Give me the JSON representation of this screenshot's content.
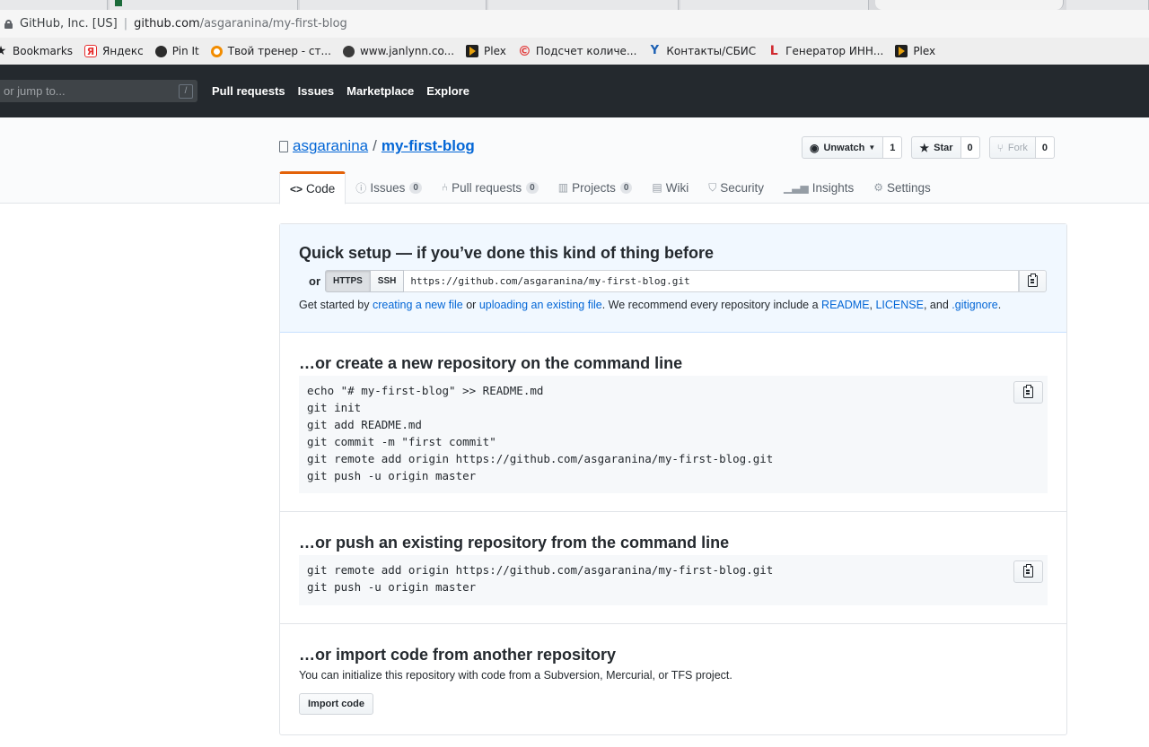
{
  "browser": {
    "org": "GitHub, Inc. [US]",
    "host": "github.com",
    "path": "/asgaranina/my-first-blog",
    "bookmarks": [
      {
        "label": "Bookmarks",
        "icon": "star-icon"
      },
      {
        "label": "Яндекс",
        "icon": "yandex-icon"
      },
      {
        "label": "Pin It",
        "icon": "pin-it-icon"
      },
      {
        "label": "Твой тренер - ст...",
        "icon": "trainer-icon"
      },
      {
        "label": "www.janlynn.co...",
        "icon": "globe-icon"
      },
      {
        "label": "Plex",
        "icon": "plex-icon"
      },
      {
        "label": "Подсчет количе...",
        "icon": "copyright-icon"
      },
      {
        "label": "Контакты/СБИС",
        "icon": "contacts-icon"
      },
      {
        "label": "Генератор ИНН...",
        "icon": "inn-icon"
      },
      {
        "label": "Plex",
        "icon": "plex-icon"
      }
    ]
  },
  "header": {
    "search_placeholder": "or jump to...",
    "slash_key": "/",
    "nav": [
      "Pull requests",
      "Issues",
      "Marketplace",
      "Explore"
    ]
  },
  "repo": {
    "owner": "asgaranina",
    "separator": "/",
    "name": "my-first-blog",
    "unwatch_label": "Unwatch",
    "watch_count": "1",
    "star_label": "Star",
    "star_count": "0",
    "fork_label": "Fork",
    "fork_count": "0",
    "tabs": [
      {
        "label": "Code",
        "icon": "code-icon"
      },
      {
        "label": "Issues",
        "icon": "issue-icon",
        "count": "0"
      },
      {
        "label": "Pull requests",
        "icon": "pull-request-icon",
        "count": "0"
      },
      {
        "label": "Projects",
        "icon": "project-icon",
        "count": "0"
      },
      {
        "label": "Wiki",
        "icon": "book-icon"
      },
      {
        "label": "Security",
        "icon": "shield-icon"
      },
      {
        "label": "Insights",
        "icon": "graph-icon"
      },
      {
        "label": "Settings",
        "icon": "gear-icon"
      }
    ]
  },
  "quick_setup": {
    "title": "Quick setup — if you’ve done this kind of thing before",
    "or": "or",
    "https": "HTTPS",
    "ssh": "SSH",
    "clone_url": "https://github.com/asgaranina/my-first-blog.git",
    "help_1": "Get started by ",
    "help_link_1": "creating a new file",
    "help_2": " or ",
    "help_link_2": "uploading an existing file",
    "help_3": ". We recommend every repository include a ",
    "help_link_3": "README",
    "help_4": ", ",
    "help_link_4": "LICENSE",
    "help_5": ", and ",
    "help_link_5": ".gitignore",
    "help_6": "."
  },
  "create_section": {
    "title": "…or create a new repository on the command line",
    "code": "echo \"# my-first-blog\" >> README.md\ngit init\ngit add README.md\ngit commit -m \"first commit\"\ngit remote add origin https://github.com/asgaranina/my-first-blog.git\ngit push -u origin master"
  },
  "push_section": {
    "title": "…or push an existing repository from the command line",
    "code": "git remote add origin https://github.com/asgaranina/my-first-blog.git\ngit push -u origin master"
  },
  "import_section": {
    "title": "…or import code from another repository",
    "description": "You can initialize this repository with code from a Subversion, Mercurial, or TFS project.",
    "button": "Import code"
  }
}
